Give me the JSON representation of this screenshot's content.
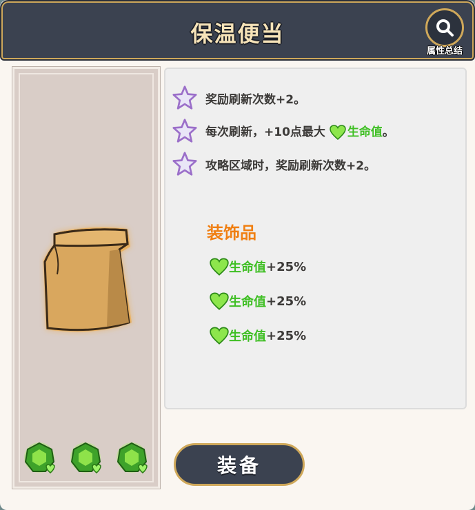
{
  "header": {
    "title": "保温便当",
    "summary_label": "属性总结"
  },
  "effects": [
    {
      "text": "奖励刷新次数+2。"
    },
    {
      "prefix": "每次刷新，+10点最大",
      "stat": "生命值",
      "suffix": "。"
    },
    {
      "text": "攻略区域时，奖励刷新次数+2。"
    }
  ],
  "decoration": {
    "title": "装饰品",
    "rows": [
      {
        "stat": "生命值",
        "value": "+25%"
      },
      {
        "stat": "生命值",
        "value": "+25%"
      },
      {
        "stat": "生命值",
        "value": "+25%"
      }
    ]
  },
  "equip_button": "装备",
  "icons": {
    "item": "paper-bag-icon",
    "gem": "green-gem-icon",
    "effect": "star-icon",
    "stat": "heart-icon",
    "summary": "magnifier-icon"
  },
  "colors": {
    "header_bg": "#3b4250",
    "gold_border": "#cfa85a",
    "stat_green": "#3fbf24",
    "deco_orange": "#f07f12"
  }
}
